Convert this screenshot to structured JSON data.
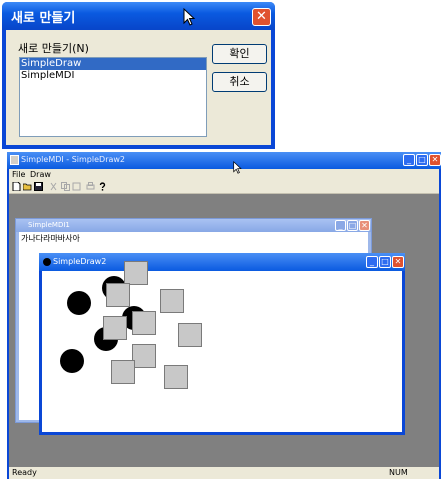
{
  "dialog": {
    "title": "새로 만들기",
    "close_glyph": "✕",
    "list_label": "새로 만들기(N)",
    "items": [
      {
        "label": "SimpleDraw",
        "selected": true
      },
      {
        "label": "SimpleMDI",
        "selected": false
      }
    ],
    "ok_label": "확인",
    "cancel_label": "취소"
  },
  "app": {
    "title": "SimpleMDI - SimpleDraw2",
    "menu": [
      "File",
      "Draw"
    ],
    "toolbar_icons": [
      "new-icon",
      "open-icon",
      "save-icon",
      "cut-icon",
      "copy-icon",
      "paste-icon",
      "print-icon",
      "help-icon"
    ],
    "status_left": "Ready",
    "status_right": "NUM"
  },
  "child1": {
    "title": "SimpleMDI1",
    "text": "가나다라마바사아"
  },
  "child2": {
    "title": "SimpleDraw2"
  },
  "colors": {
    "titlebar": "#0a5ae0",
    "close": "#e0522f",
    "selection": "#316ac5",
    "mdi_background": "#808080"
  }
}
